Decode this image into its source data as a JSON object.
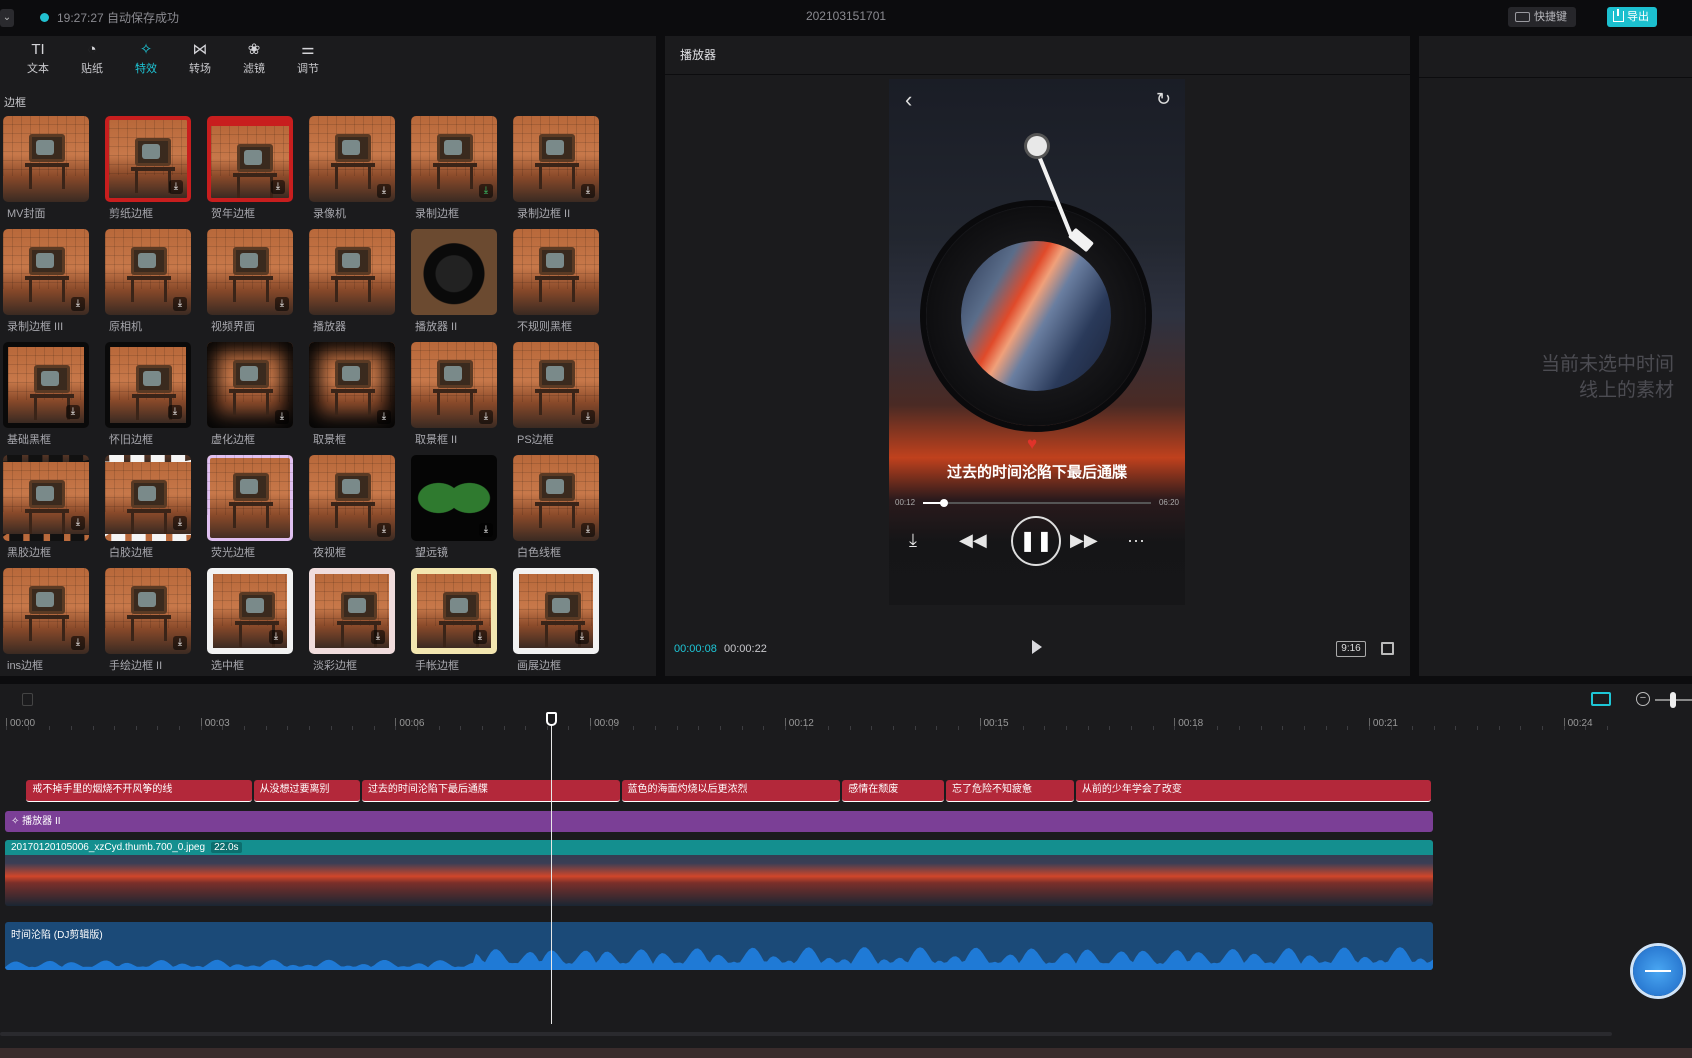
{
  "topbar": {
    "save_status": "19:27:27 自动保存成功",
    "project_name": "202103151701",
    "shortcut_label": "快捷键",
    "export_label": "导出"
  },
  "tabs": [
    {
      "label": "文本",
      "icon": "TI"
    },
    {
      "label": "贴纸",
      "icon": "◔"
    },
    {
      "label": "特效",
      "icon": "✧"
    },
    {
      "label": "转场",
      "icon": "⋈"
    },
    {
      "label": "滤镜",
      "icon": "❀"
    },
    {
      "label": "调节",
      "icon": "⚌"
    }
  ],
  "section_label": "边框",
  "effects": [
    {
      "name": "MV封面",
      "frame": "",
      "dl": ""
    },
    {
      "name": "剪纸边框",
      "frame": "fr-red",
      "dl": "⤓"
    },
    {
      "name": "贺年边框",
      "frame": "fr-red2",
      "dl": "⤓"
    },
    {
      "name": "录像机",
      "frame": "",
      "dl": "⤓"
    },
    {
      "name": "录制边框",
      "frame": "",
      "dl": "⤓",
      "dl_green": true
    },
    {
      "name": "录制边框 II",
      "frame": "",
      "dl": "⤓"
    },
    {
      "name": "录制边框 III",
      "frame": "",
      "dl": "⤓"
    },
    {
      "name": "原相机",
      "frame": "",
      "dl": "⤓"
    },
    {
      "name": "视频界面",
      "frame": "",
      "dl": "⤓"
    },
    {
      "name": "播放器",
      "frame": "",
      "dl": ""
    },
    {
      "name": "播放器 II",
      "frame": "fr-vinyl",
      "dl": ""
    },
    {
      "name": "不规则黑框",
      "frame": "",
      "dl": ""
    },
    {
      "name": "基础黑框",
      "frame": "fr-black",
      "dl": "⤓"
    },
    {
      "name": "怀旧边框",
      "frame": "fr-black",
      "dl": "⤓"
    },
    {
      "name": "虚化边框",
      "frame": "fr-dark",
      "dl": "⤓"
    },
    {
      "name": "取景框",
      "frame": "fr-dark",
      "dl": "⤓"
    },
    {
      "name": "取景框 II",
      "frame": "",
      "dl": "⤓"
    },
    {
      "name": "PS边框",
      "frame": "",
      "dl": "⤓"
    },
    {
      "name": "黑胶边框",
      "frame": "fr-film",
      "dl": "⤓"
    },
    {
      "name": "白胶边框",
      "frame": "fr-wfilm",
      "dl": "⤓"
    },
    {
      "name": "荧光边框",
      "frame": "fr-neon",
      "dl": ""
    },
    {
      "name": "夜视框",
      "frame": "",
      "dl": "⤓"
    },
    {
      "name": "望远镜",
      "frame": "fr-scope",
      "dl": "⤓"
    },
    {
      "name": "白色线框",
      "frame": "",
      "dl": "⤓"
    },
    {
      "name": "ins边框",
      "frame": "",
      "dl": "⤓"
    },
    {
      "name": "手绘边框 II",
      "frame": "",
      "dl": "⤓"
    },
    {
      "name": "选中框",
      "frame": "fr-white",
      "dl": "⤓"
    },
    {
      "name": "淡彩边框",
      "frame": "fr-pink",
      "dl": "⤓"
    },
    {
      "name": "手帐边框",
      "frame": "fr-yellow",
      "dl": "⤓"
    },
    {
      "name": "画展边框",
      "frame": "fr-white",
      "dl": "⤓"
    }
  ],
  "player": {
    "title": "播放器",
    "lyric": "过去的时间沦陷下最后通牒",
    "phone_time_cur": "00:12",
    "phone_time_total": "06:20",
    "phone_progress": 0.09,
    "time_current": "00:00:08",
    "time_total": "00:00:22",
    "ratio": "9:16"
  },
  "right_panel": {
    "empty_line1": "当前未选中时间",
    "empty_line2": "线上的素材"
  },
  "timeline": {
    "ruler": [
      "00:00",
      "00:03",
      "00:06",
      "00:09",
      "00:12",
      "00:15",
      "00:18",
      "00:21",
      "00:24"
    ],
    "lyric_clips": [
      {
        "text": "戒不掉手里的烟烧不开风筝的线",
        "start": 0.33,
        "end": 3.83
      },
      {
        "text": "从没想过要离别",
        "start": 3.83,
        "end": 5.5
      },
      {
        "text": "过去的时间沦陷下最后通牒",
        "start": 5.5,
        "end": 9.5
      },
      {
        "text": "蓝色的海面灼烧以后更浓烈",
        "start": 9.5,
        "end": 12.9
      },
      {
        "text": "感情在颓废",
        "start": 12.9,
        "end": 14.5
      },
      {
        "text": "忘了危险不知疲惫",
        "start": 14.5,
        "end": 16.5
      },
      {
        "text": "从前的少年学会了改变",
        "start": 16.5,
        "end": 22.0
      }
    ],
    "effect_track": "播放器 II",
    "video_name": "20170120105006_xzCyd.thumb.700_0.jpeg",
    "video_duration": "22.0s",
    "audio_name": "时间沦陷 (DJ剪辑版)",
    "playhead_seconds": 8.4
  },
  "colors": {
    "accent": "#1ec6d6",
    "lyric_clip": "#b3283a",
    "effect_track": "#7b3f96",
    "video_head": "#148f8f",
    "audio_track": "#1b4a78"
  }
}
